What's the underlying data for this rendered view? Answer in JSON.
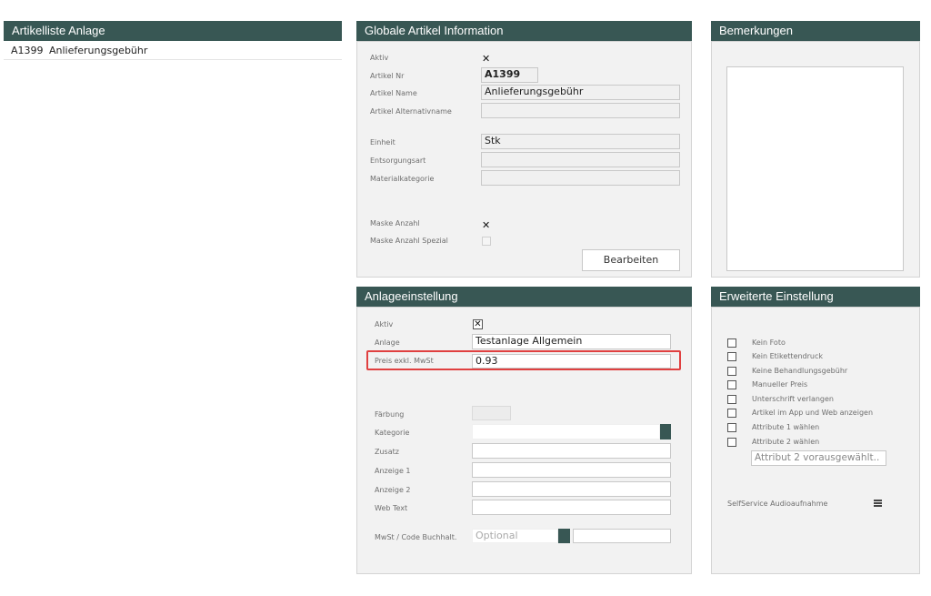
{
  "list_panel": {
    "title": "Artikelliste Anlage",
    "items": [
      {
        "code": "A1399",
        "name": "Anlieferungsgebühr"
      }
    ]
  },
  "global_info": {
    "title": "Globale Artikel Information",
    "aktiv_label": "Aktiv",
    "aktiv_mark": "✕",
    "artikel_nr_label": "Artikel Nr",
    "artikel_nr_value": "A1399",
    "artikel_name_label": "Artikel Name",
    "artikel_name_value": "Anlieferungsgebühr",
    "alternativname_label": "Artikel Alternativname",
    "alternativname_value": "",
    "einheit_label": "Einheit",
    "einheit_value": "Stk",
    "entsorgungsart_label": "Entsorgungsart",
    "entsorgungsart_value": "",
    "materialkategorie_label": "Materialkategorie",
    "materialkategorie_value": "",
    "maske_anzahl_label": "Maske Anzahl",
    "maske_anzahl_mark": "✕",
    "maske_anzahl_spezial_label": "Maske Anzahl Spezial",
    "edit_button": "Bearbeiten"
  },
  "remarks": {
    "title": "Bemerkungen",
    "text": ""
  },
  "anlage": {
    "title": "Anlageeinstellung",
    "aktiv_label": "Aktiv",
    "aktiv_mark": "✕",
    "anlage_label": "Anlage",
    "anlage_value": "Testanlage Allgemein",
    "preis_label": "Preis exkl. MwSt",
    "preis_value": "0.93",
    "faerbung_label": "Färbung",
    "kategorie_label": "Kategorie",
    "zusatz_label": "Zusatz",
    "anzeige1_label": "Anzeige 1",
    "anzeige2_label": "Anzeige 2",
    "webtext_label": "Web Text",
    "mwst_label": "MwSt / Code Buchhalt.",
    "mwst_placeholder": "Optional",
    "highlight_color": "#e04040"
  },
  "extended": {
    "title": "Erweiterte Einstellung",
    "options": [
      "Kein Foto",
      "Kein Etikettendruck",
      "Keine Behandlungsgebühr",
      "Manueller Preis",
      "Unterschrift verlangen",
      "Artikel im App und Web anzeigen",
      "Attribute 1 wählen",
      "Attribute 2 wählen"
    ],
    "attribute2_placeholder": "Attribut 2 vorausgewählt..",
    "audio_label": "SelfService Audioaufnahme",
    "menu_icon": "hamburger-menu-icon"
  },
  "colors": {
    "header": "#385754",
    "panel_bg": "#f2f2f2"
  }
}
